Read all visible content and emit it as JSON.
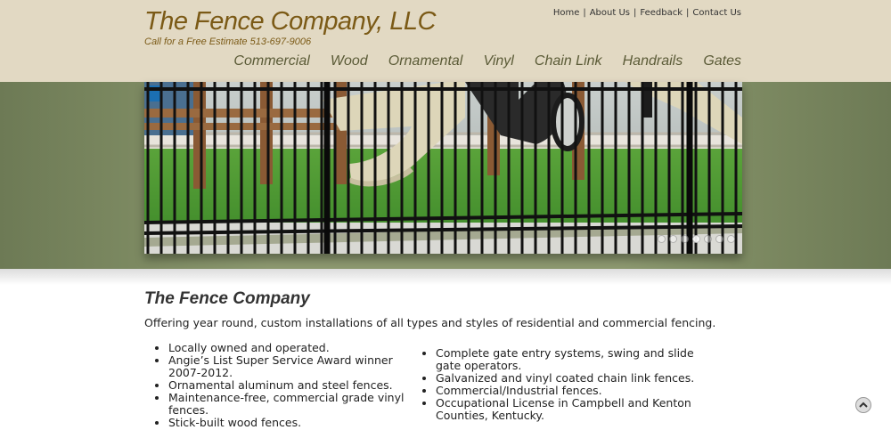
{
  "site": {
    "title": "The Fence Company, LLC",
    "tagline": "Call for a Free Estimate 513-697-9006"
  },
  "top_links": [
    "Home",
    "About Us",
    "Feedback",
    "Contact Us"
  ],
  "nav": [
    "Commercial",
    "Wood",
    "Ornamental",
    "Vinyl",
    "Chain Link",
    "Handrails",
    "Gates"
  ],
  "hero": {
    "slide_count": 7,
    "active_slide": 3
  },
  "main": {
    "title": "The Fence Company",
    "intro": "Offering year round, custom installations of all types and styles of residential and commercial fencing.",
    "left_list": [
      "Locally owned and operated.",
      "Angie’s List Super Service Award winner 2007-2012.",
      "Ornamental aluminum and steel fences.",
      "Maintenance-free, commercial grade vinyl fences.",
      "Stick-built wood fences."
    ],
    "right_list": [
      "Complete gate entry systems, swing and slide gate operators.",
      "Galvanized and vinyl coated chain link fences.",
      "Commercial/Industrial fences.",
      "Occupational License in Campbell and Kenton Counties, Kentucky."
    ]
  },
  "colors": {
    "header_bg": "#e2d9c3",
    "brand": "#7b5a16",
    "nav_text": "#5b5b37",
    "band": "#8d9970"
  },
  "icons": {
    "scroll_top": "chevron-up-icon"
  }
}
